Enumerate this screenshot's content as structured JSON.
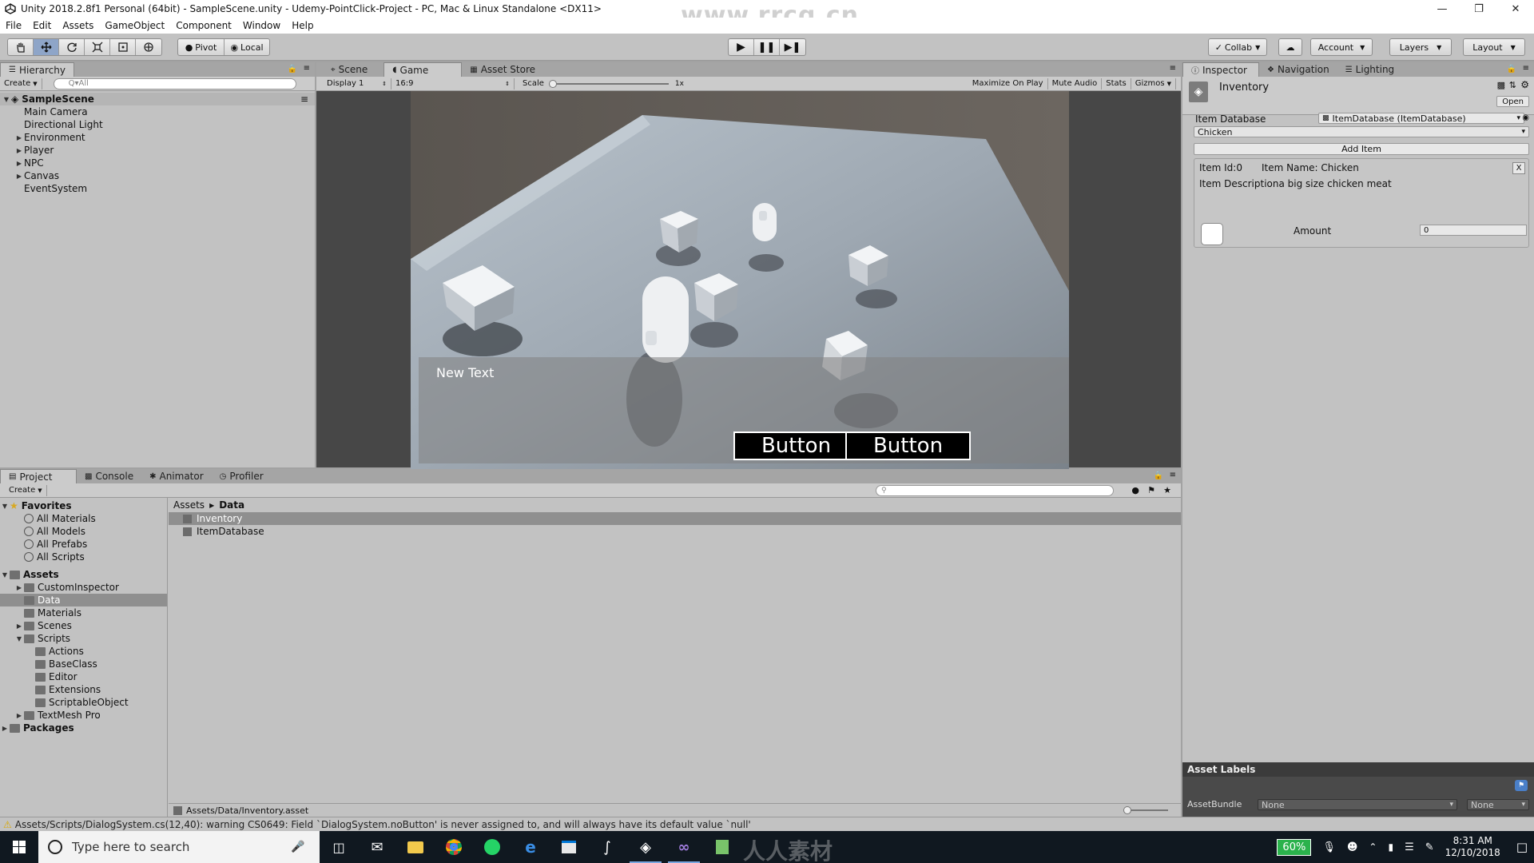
{
  "window": {
    "title": "Unity 2018.2.8f1 Personal (64bit) - SampleScene.unity - Udemy-PointClick-Project - PC, Mac & Linux Standalone <DX11>",
    "watermark": "www.rrcg.cn"
  },
  "menu": [
    "File",
    "Edit",
    "Assets",
    "GameObject",
    "Component",
    "Window",
    "Help"
  ],
  "toolbar": {
    "pivot": "Pivot",
    "local": "Local",
    "collab": "Collab",
    "account": "Account",
    "layers": "Layers",
    "layout": "Layout"
  },
  "hierarchy": {
    "tab": "Hierarchy",
    "create": "Create",
    "search_placeholder": "Q▾All",
    "scene": "SampleScene",
    "items": [
      {
        "label": "Main Camera",
        "expandable": false
      },
      {
        "label": "Directional Light",
        "expandable": false
      },
      {
        "label": "Environment",
        "expandable": true
      },
      {
        "label": "Player",
        "expandable": true
      },
      {
        "label": "NPC",
        "expandable": true
      },
      {
        "label": "Canvas",
        "expandable": true
      },
      {
        "label": "EventSystem",
        "expandable": false
      }
    ]
  },
  "game": {
    "tabs": [
      "Scene",
      "Game",
      "Asset Store"
    ],
    "display": "Display 1",
    "aspect": "16:9",
    "scale_label": "Scale",
    "scale_value": "1x",
    "options": [
      "Maximize On Play",
      "Mute Audio",
      "Stats",
      "Gizmos"
    ],
    "canvas_text": "New Text",
    "button_1": "Button",
    "button_2": "Button"
  },
  "inspector": {
    "tabs": [
      "Inspector",
      "Navigation",
      "Lighting"
    ],
    "object_name": "Inventory",
    "open_button": "Open",
    "item_database_label": "Item Database",
    "item_database_value": "ItemDatabase (ItemDatabase)",
    "item_dropdown": "Chicken",
    "add_item": "Add Item",
    "item_id": "Item Id:0",
    "item_name": "Item Name: Chicken",
    "remove_label": "X",
    "item_description": "Item Descriptiona big size chicken meat",
    "amount_label": "Amount",
    "amount_value": "0",
    "asset_labels": "Asset Labels",
    "assetbundle_label": "AssetBundle",
    "assetbundle_value": "None",
    "assetbundle_variant": "None"
  },
  "project": {
    "tabs": [
      "Project",
      "Console",
      "Animator",
      "Profiler"
    ],
    "create": "Create",
    "favorites_label": "Favorites",
    "favorites": [
      "All Materials",
      "All Models",
      "All Prefabs",
      "All Scripts"
    ],
    "assets_label": "Assets",
    "folders": [
      {
        "label": "CustomInspector",
        "depth": 1,
        "arrow": "▶",
        "selected": false
      },
      {
        "label": "Data",
        "depth": 1,
        "arrow": "",
        "selected": true
      },
      {
        "label": "Materials",
        "depth": 1,
        "arrow": "",
        "selected": false
      },
      {
        "label": "Scenes",
        "depth": 1,
        "arrow": "▶",
        "selected": false
      },
      {
        "label": "Scripts",
        "depth": 1,
        "arrow": "▼",
        "selected": false
      },
      {
        "label": "Actions",
        "depth": 2,
        "arrow": "",
        "selected": false
      },
      {
        "label": "BaseClass",
        "depth": 2,
        "arrow": "",
        "selected": false
      },
      {
        "label": "Editor",
        "depth": 2,
        "arrow": "",
        "selected": false
      },
      {
        "label": "Extensions",
        "depth": 2,
        "arrow": "",
        "selected": false
      },
      {
        "label": "ScriptableObject",
        "depth": 2,
        "arrow": "",
        "selected": false
      },
      {
        "label": "TextMesh Pro",
        "depth": 1,
        "arrow": "▶",
        "selected": false
      }
    ],
    "packages_label": "Packages",
    "breadcrumb_root": "Assets",
    "breadcrumb_current": "Data",
    "files": [
      {
        "label": "Inventory",
        "selected": true
      },
      {
        "label": "ItemDatabase",
        "selected": false
      }
    ],
    "selected_path": "Assets/Data/Inventory.asset"
  },
  "status": {
    "message": "Assets/Scripts/DialogSystem.cs(12,40): warning CS0649: Field `DialogSystem.noButton' is never assigned to, and will always have its default value `null'"
  },
  "taskbar": {
    "search_placeholder": "Type here to search",
    "battery": "60%",
    "time": "8:31 AM",
    "date": "12/10/2018",
    "watermark": "人人素材"
  },
  "colors": {
    "editor_bg": "#c2c2c2",
    "tab_bar": "#a5a5a5",
    "selection": "#8f8f8f",
    "taskbar": "#101820",
    "battery_green": "#2bb24c"
  }
}
